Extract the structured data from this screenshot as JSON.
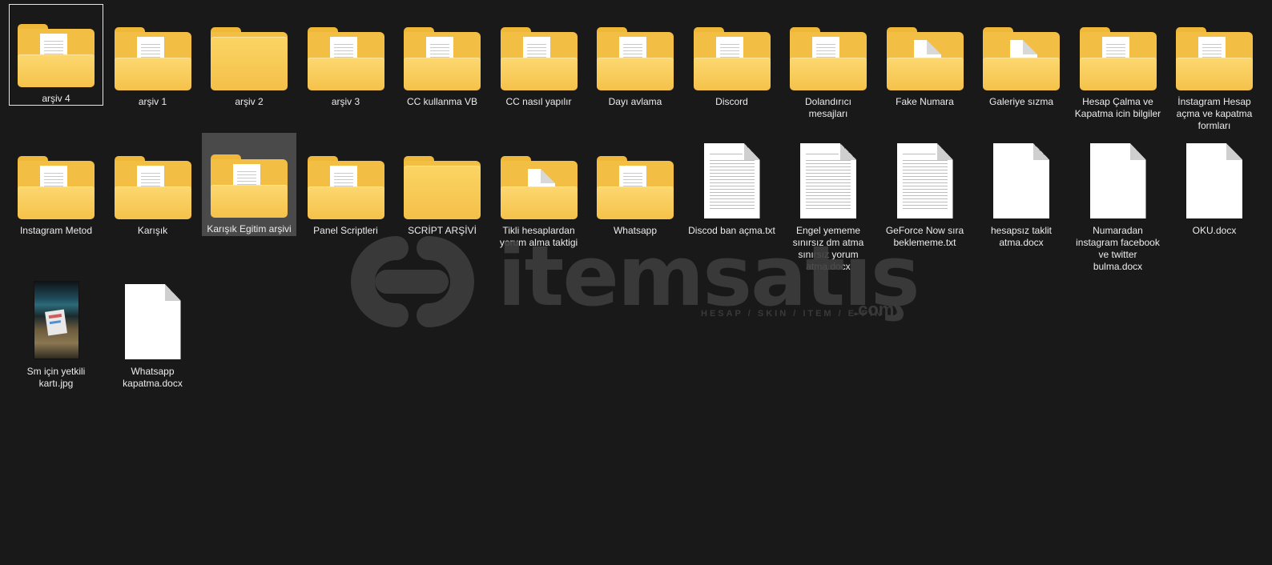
{
  "items": [
    {
      "label": "arşiv 4",
      "icon": "folder-with-documents-icon",
      "kind": "folder",
      "state": "selected"
    },
    {
      "label": "arşiv 1",
      "icon": "folder-with-documents-icon",
      "kind": "folder"
    },
    {
      "label": "arşiv 2",
      "icon": "empty-folder-icon",
      "kind": "folder-plain"
    },
    {
      "label": "arşiv 3",
      "icon": "folder-with-documents-icon",
      "kind": "folder"
    },
    {
      "label": "CC kullanma VB",
      "icon": "folder-with-documents-icon",
      "kind": "folder"
    },
    {
      "label": "CC nasıl yapılır",
      "icon": "folder-with-documents-icon",
      "kind": "folder"
    },
    {
      "label": "Dayı avlama",
      "icon": "folder-with-documents-icon",
      "kind": "folder"
    },
    {
      "label": "Discord",
      "icon": "folder-with-documents-icon",
      "kind": "folder"
    },
    {
      "label": "Dolandırıcı mesajları",
      "icon": "folder-with-documents-icon",
      "kind": "folder"
    },
    {
      "label": "Fake Numara",
      "icon": "folder-with-blank-page-icon",
      "kind": "folder-blank"
    },
    {
      "label": "Galeriye sızma",
      "icon": "folder-with-blank-page-icon",
      "kind": "folder-blank"
    },
    {
      "label": "Hesap Çalma ve Kapatma icin bilgiler",
      "icon": "folder-with-documents-icon",
      "kind": "folder"
    },
    {
      "label": "İnstagram Hesap açma ve kapatma formları",
      "icon": "folder-with-documents-icon",
      "kind": "folder"
    },
    {
      "label": "Instagram Metod",
      "icon": "folder-with-documents-icon",
      "kind": "folder"
    },
    {
      "label": "Karışık",
      "icon": "folder-with-documents-icon",
      "kind": "folder"
    },
    {
      "label": "Karışık Egitim arşivi",
      "icon": "folder-with-documents-icon",
      "kind": "folder",
      "state": "hovered"
    },
    {
      "label": "Panel Scriptleri",
      "icon": "folder-with-documents-icon",
      "kind": "folder"
    },
    {
      "label": "SCRİPT ARŞİVİ",
      "icon": "empty-folder-icon",
      "kind": "folder-plain"
    },
    {
      "label": "Tikli hesaplardan yorum alma taktigi",
      "icon": "folder-with-blank-page-icon",
      "kind": "folder-blank"
    },
    {
      "label": "Whatsapp",
      "icon": "folder-with-documents-icon",
      "kind": "folder"
    },
    {
      "label": "Discod ban açma.txt",
      "icon": "text-file-icon",
      "kind": "txt"
    },
    {
      "label": "Engel yememe sınırsız dm atma sınırsız yorum atma.docx",
      "icon": "document-file-icon",
      "kind": "docx-lines"
    },
    {
      "label": "GeForce Now sıra beklememe.txt",
      "icon": "text-file-icon",
      "kind": "txt"
    },
    {
      "label": "hesapsız taklit atma.docx",
      "icon": "document-file-icon",
      "kind": "docx"
    },
    {
      "label": "Numaradan instagram facebook ve twitter bulma.docx",
      "icon": "document-file-icon",
      "kind": "docx"
    },
    {
      "label": "OKU.docx",
      "icon": "document-file-icon",
      "kind": "docx"
    },
    {
      "label": "Sm için yetkili kartı.jpg",
      "icon": "image-thumbnail-icon",
      "kind": "photo"
    },
    {
      "label": "Whatsapp kapatma.docx",
      "icon": "document-file-icon",
      "kind": "docx"
    }
  ],
  "watermark": {
    "brand": "itemsatış",
    "tagline": "HESAP / SKIN / ITEM / E-PIN",
    "suffix": ".com"
  }
}
